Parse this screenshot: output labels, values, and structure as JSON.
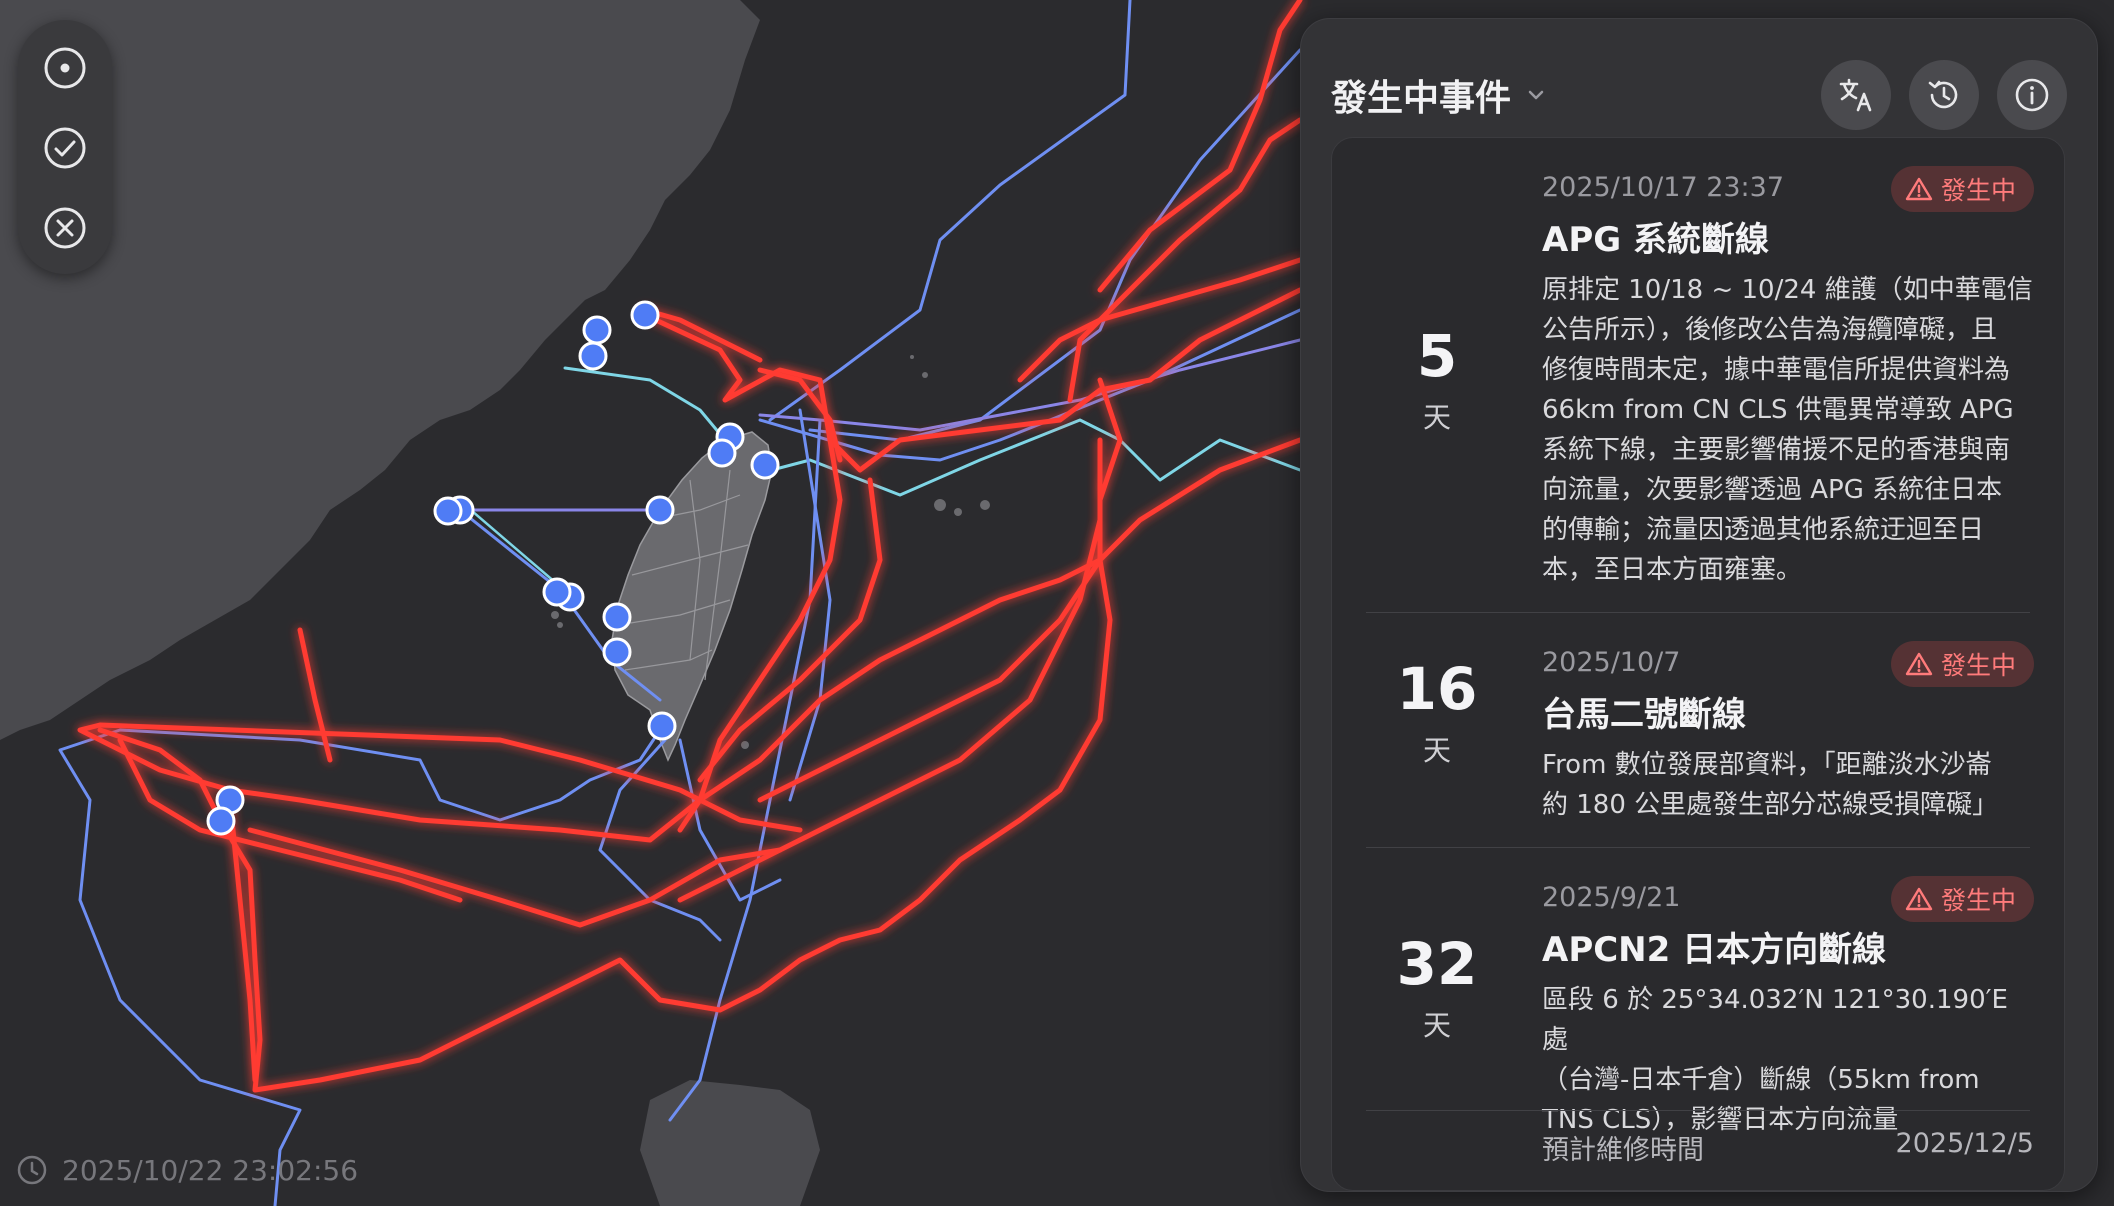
{
  "map": {
    "timestamp": "2025/10/22 23:02:56",
    "controls": [
      {
        "name": "locate-icon"
      },
      {
        "name": "check-circle-icon"
      },
      {
        "name": "close-circle-icon"
      }
    ],
    "colors": {
      "land": "#4a4a4e",
      "sea": "#2b2b2e",
      "cut_cable": "#ff3b30",
      "cable_blue": "#6f8ff2",
      "cable_cyan": "#7fd6e6",
      "landing_point": "#4f7cf5"
    }
  },
  "panel": {
    "title": "發生中事件",
    "header_icons": [
      "translate-icon",
      "history-icon",
      "info-icon"
    ],
    "events": [
      {
        "days": "5",
        "unit": "天",
        "date": "2025/10/17 23:37",
        "status": "發生中",
        "title": "APG 系統斷線",
        "desc_lines": [
          "原排定 10/18 ~ 10/24 維護（如中華電信",
          "公告所示），後修改公告為海纜障礙，且",
          "修復時間未定，據中華電信所提供資料為",
          "66km from CN CLS 供電異常導致 APG",
          "系統下線，主要影響備援不足的香港與南",
          "向流量，次要影響透過 APG 系統往日本",
          "的傳輸；流量因透過其他系統迂迴至日",
          "本，至日本方面雍塞。"
        ]
      },
      {
        "days": "16",
        "unit": "天",
        "date": "2025/10/7",
        "status": "發生中",
        "title": "台馬二號斷線",
        "desc_lines": [
          "From 數位發展部資料，「距離淡水沙崙",
          "約 180 公里處發生部分芯線受損障礙」"
        ]
      },
      {
        "days": "32",
        "unit": "天",
        "date": "2025/9/21",
        "status": "發生中",
        "title": "APCN2 日本方向斷線",
        "desc_lines": [
          "區段 6 於 25°34.032′N 121°30.190′E 處",
          "（台灣-日本千倉）斷線（55km from",
          "TNS CLS），影響日本方向流量"
        ],
        "repair_label": "預計維修時間",
        "repair_date": "2025/12/5"
      }
    ]
  }
}
